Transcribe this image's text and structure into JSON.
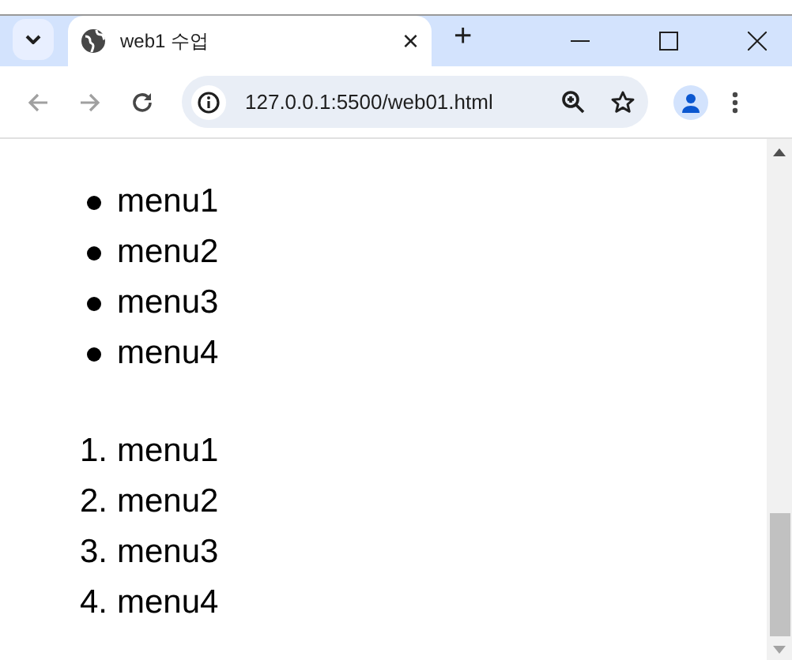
{
  "tab": {
    "title": "web1 수업",
    "close": "×",
    "selected": true
  },
  "new_tab": "+",
  "address_bar": {
    "url": "127.0.0.1:5500/web01.html"
  },
  "unordered_list": [
    {
      "text": "menu1"
    },
    {
      "text": "menu2"
    },
    {
      "text": "menu3"
    },
    {
      "text": "menu4"
    }
  ],
  "ordered_list": [
    {
      "number": "1.",
      "text": "menu1"
    },
    {
      "number": "2.",
      "text": "menu2"
    },
    {
      "number": "3.",
      "text": "menu3"
    },
    {
      "number": "4.",
      "text": "menu4"
    }
  ]
}
